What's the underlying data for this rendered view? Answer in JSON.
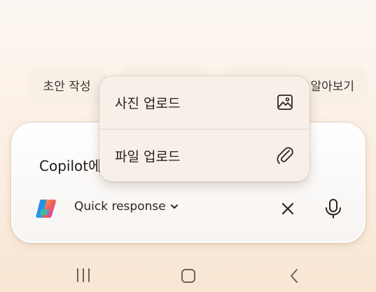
{
  "suggestions": [
    {
      "label": "초안 작성"
    },
    {
      "label": ""
    },
    {
      "label": "알아보기"
    }
  ],
  "composer": {
    "input_text": "Copilot에",
    "mode_label": "Quick response"
  },
  "upload_menu": {
    "items": [
      {
        "label": "사진 업로드",
        "icon": "image-icon"
      },
      {
        "label": "파일 업로드",
        "icon": "paperclip-icon"
      }
    ]
  },
  "icons": {
    "logo": "copilot-logo-icon",
    "close": "close-icon",
    "mic": "microphone-icon",
    "nav_recents": "recents-icon",
    "nav_home": "home-icon",
    "nav_back": "back-icon"
  },
  "colors": {
    "background": "#fbeee1",
    "chip": "#f8efe6",
    "menu": "#f7f0e8",
    "text": "#231e1a"
  }
}
